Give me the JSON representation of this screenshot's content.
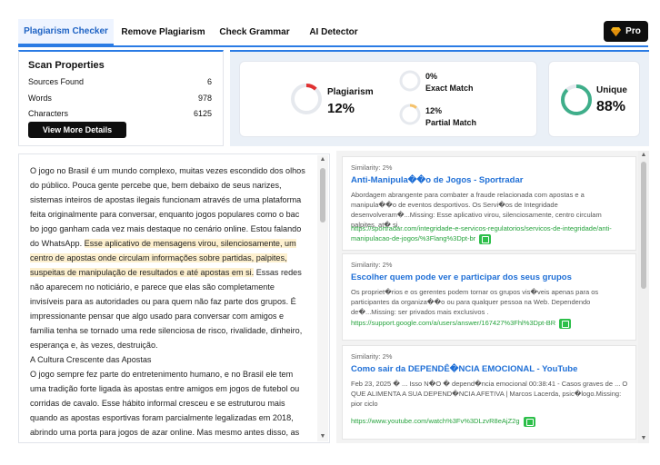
{
  "tabs": [
    {
      "label": "Plagiarism Checker",
      "active": true
    },
    {
      "label": "Remove Plagiarism",
      "active": false
    },
    {
      "label": "Check Grammar",
      "active": false
    },
    {
      "label": "AI Detector",
      "active": false
    }
  ],
  "pro_button": {
    "label": "Pro",
    "icon": "diamond-icon"
  },
  "scan": {
    "title": "Scan Properties",
    "rows": [
      {
        "label": "Sources Found",
        "value": "6"
      },
      {
        "label": "Words",
        "value": "978"
      },
      {
        "label": "Characters",
        "value": "6125"
      }
    ],
    "details_button": "View More Details"
  },
  "stats": {
    "plagiarism": {
      "label": "Plagiarism",
      "value": "12%",
      "fraction": 0.12,
      "color": "#e03131"
    },
    "exact": {
      "label": "Exact Match",
      "value": "0%",
      "fraction": 0.0,
      "color": "#9aa3b0"
    },
    "partial": {
      "label": "Partial Match",
      "value": "12%",
      "fraction": 0.12,
      "color": "#f5c26b"
    },
    "unique": {
      "label": "Unique",
      "value": "88%",
      "fraction": 0.88,
      "color": "#3fae8a"
    }
  },
  "text": {
    "p1_before": "O jogo no Brasil é um mundo complexo, muitas vezes escondido dos olhos do público. Pouca gente percebe que, bem debaixo de seus narizes, sistemas inteiros de apostas ilegais funcionam através de uma plataforma feita originalmente para conversar, enquanto jogos populares como o bac bo jogo ganham cada vez mais destaque no cenário online. Estou falando do WhatsApp. ",
    "p1_highlight": "Esse aplicativo de mensagens virou, silenciosamente, um centro de apostas onde circulam informações sobre partidas, palpites, suspeitas de manipulação de resultados e até apostas em si.",
    "p1_after": " Essas redes não aparecem no noticiário, e parece que elas são completamente invisíveis para as autoridades ou para quem não faz parte dos grupos. É impressionante pensar que algo usado para conversar com amigos e família tenha se tornado uma rede silenciosa de risco, rivalidade, dinheiro, esperança e, às vezes, destruição.",
    "heading": "A Cultura Crescente das Apostas",
    "p2": "O jogo sempre fez parte do entretenimento humano, e no Brasil ele tem uma tradição forte ligada às apostas entre amigos em jogos de futebol ou corridas de cavalo. Esse hábito informal cresceu e se estruturou mais quando as apostas esportivas foram parcialmente legalizadas em 2018, abrindo uma porta para jogos de azar online. Mas mesmo antes disso, as redes informais já estavam a todo vapor. Pessoas que antes"
  },
  "results": [
    {
      "similarity": "Similarity: 2%",
      "title": "Anti-Manipula��o de Jogos - Sportradar",
      "desc": "Abordagem abrangente para combater a fraude relacionada com apostas e a manipula��o de eventos desportivos. Os Servi�os de Integridade desenvolveram�...Missing: Esse aplicativo virou, silenciosamente, centro circulam palpites, at� si.",
      "url": "https://sportradar.com/integridade-e-servicos-regulatorios/servicos-de-integridade/anti-manipulacao-de-jogos/%3Flang%3Dpt-br"
    },
    {
      "similarity": "Similarity: 2%",
      "title": "Escolher quem pode ver e participar dos seus grupos",
      "desc": "Os propriet�rios e os gerentes podem tornar os grupos vis�veis apenas para os participantes da organiza��o ou para qualquer pessoa na Web. Dependendo de�...Missing: ser privados mais exclusivos .",
      "url": "https://support.google.com/a/users/answer/167427%3Fhl%3Dpt-BR"
    },
    {
      "similarity": "Similarity: 2%",
      "title": "Como sair da DEPENDÊ�NCIA EMOCIONAL - YouTube",
      "desc": "Feb 23, 2025 � ... Isso N�O � depend�ncia emocional 00:38:41 - Casos graves de ... O QUE ALIMENTA A SUA DEPEND�NCIA AFETIVA | Marcos Lacerda, psic�logo.Missing: pior ciclo",
      "url": "https://www.youtube.com/watch%3Fv%3DLzvR8eAjZ2g"
    }
  ]
}
